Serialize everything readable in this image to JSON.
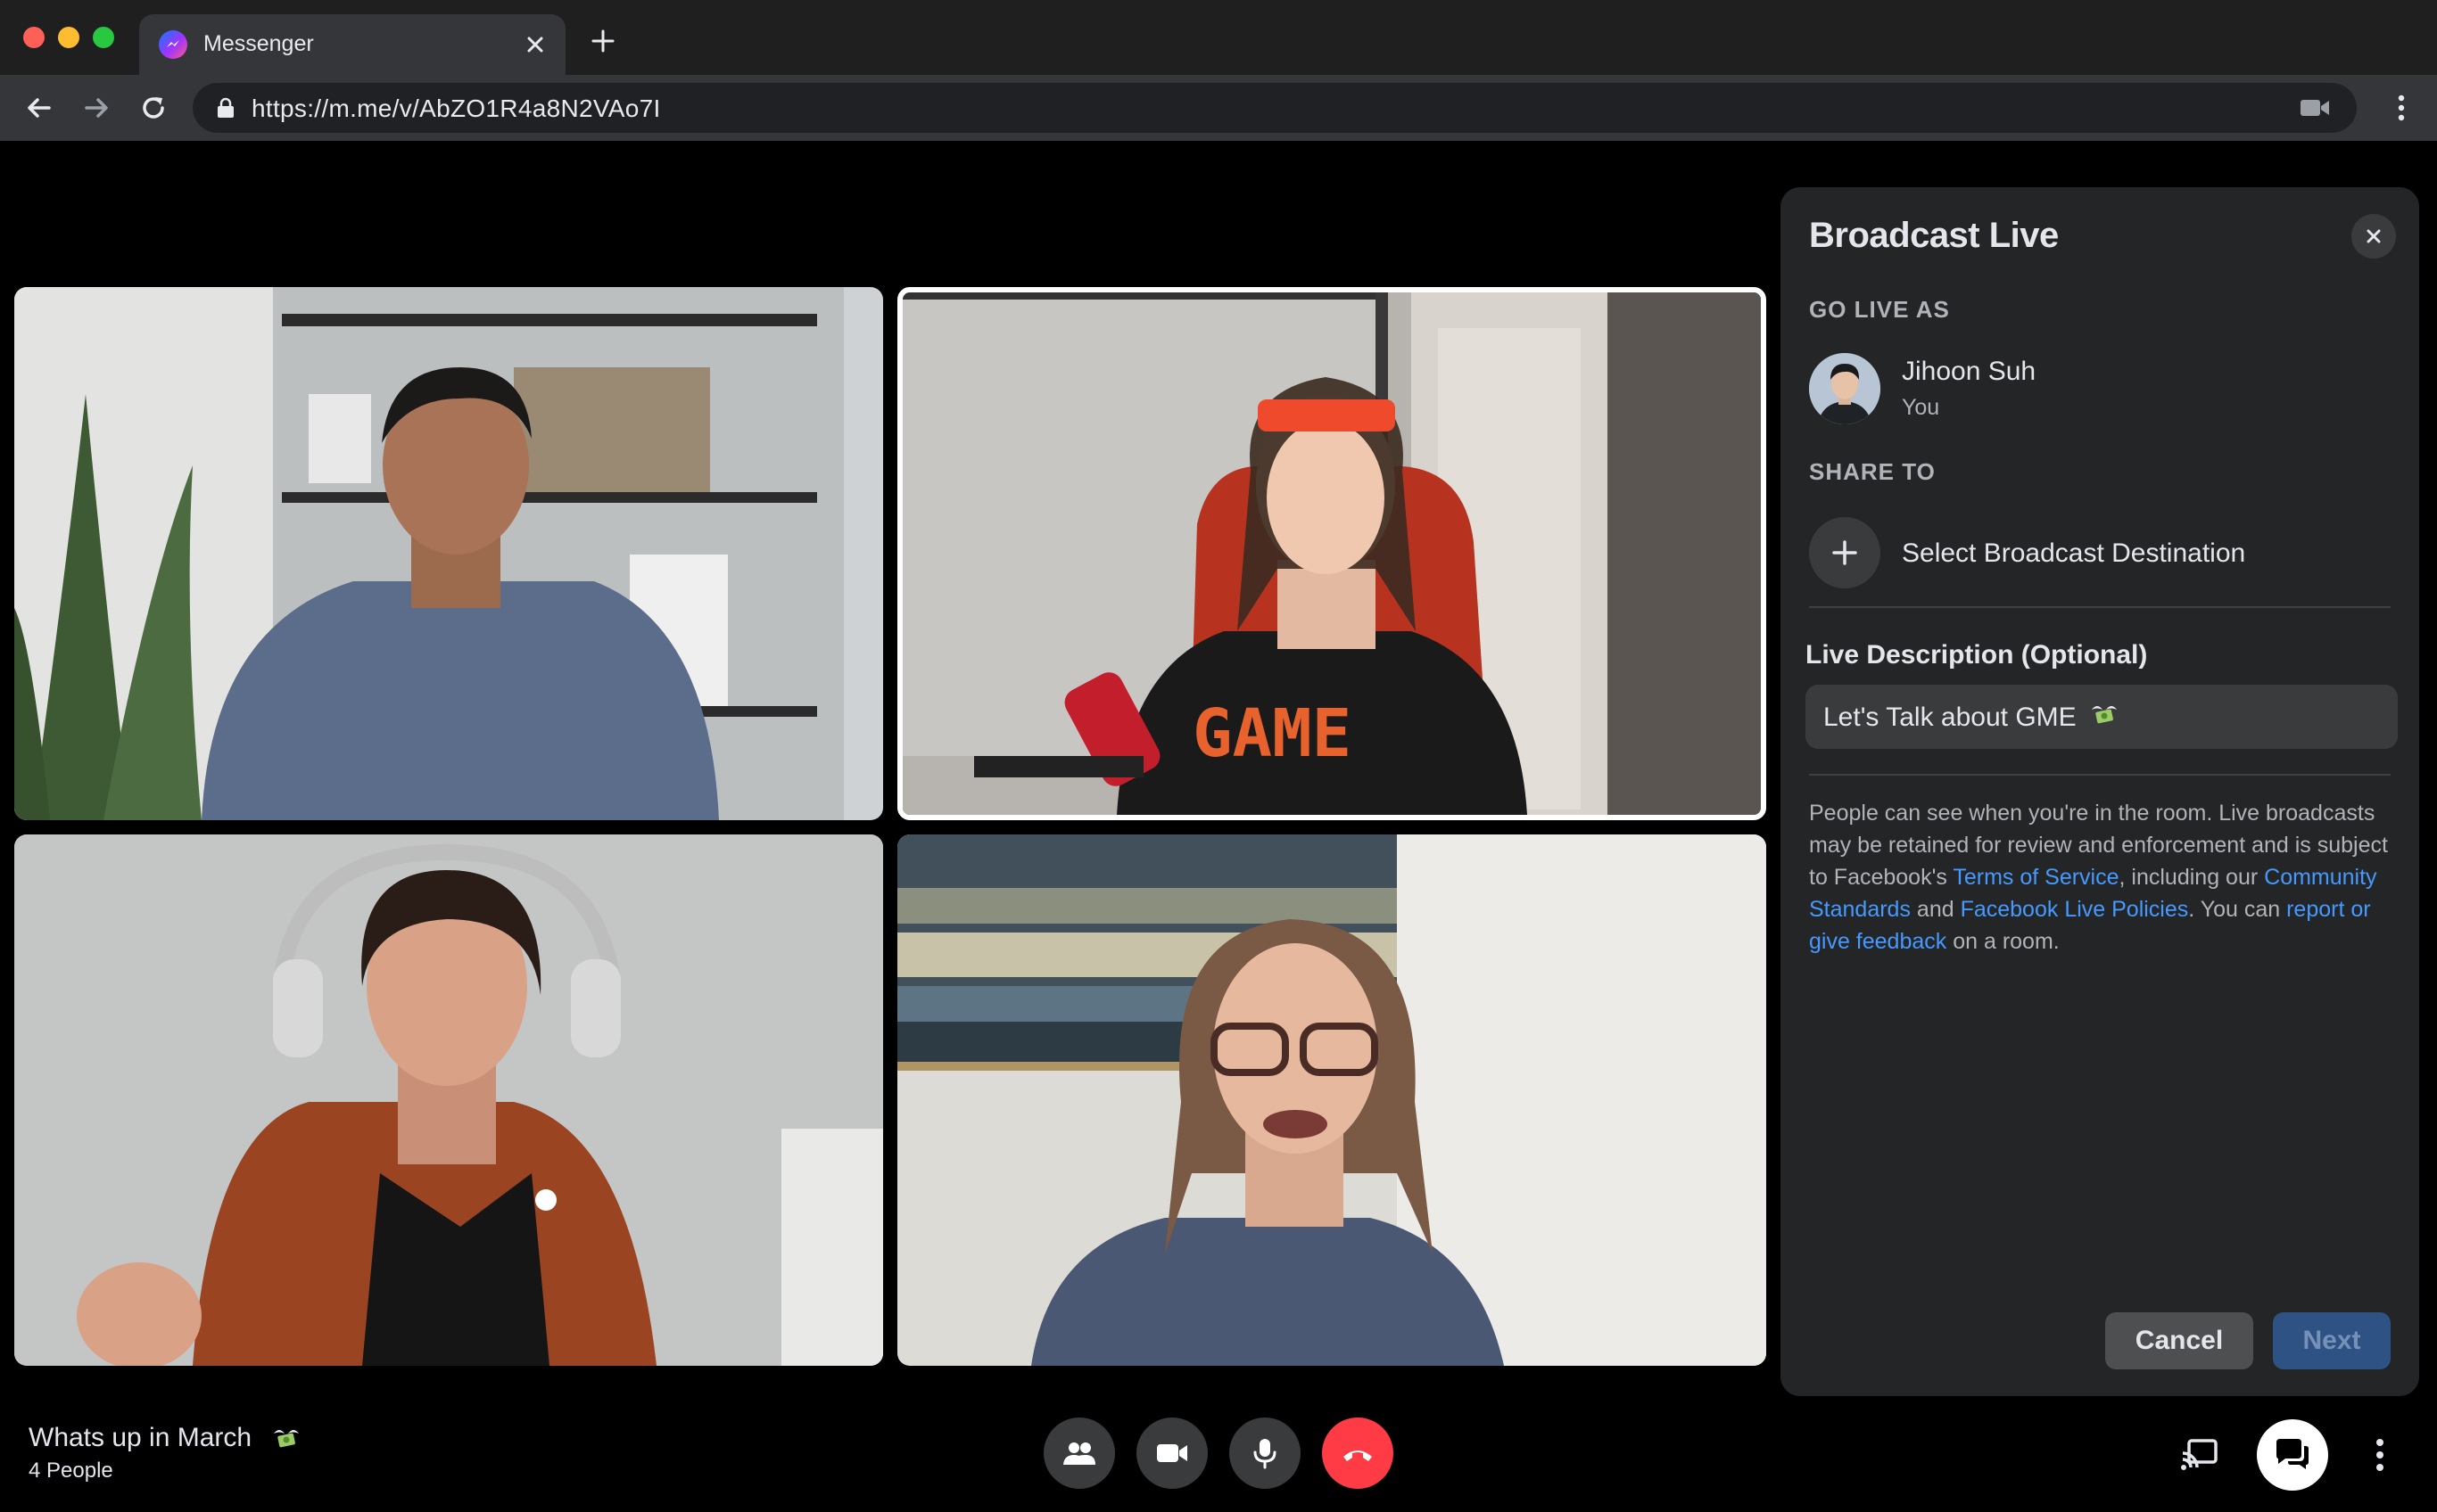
{
  "browser": {
    "tab_title": "Messenger",
    "url": "https://m.me/v/AbZO1R4a8N2VAo7I"
  },
  "video_grid": {
    "participants": [
      {
        "position": "top-left",
        "active_speaker": false
      },
      {
        "position": "top-right",
        "active_speaker": true,
        "shirt_text": "GAME"
      },
      {
        "position": "bottom-left",
        "active_speaker": false
      },
      {
        "position": "bottom-right",
        "active_speaker": false
      }
    ]
  },
  "broadcast_panel": {
    "title": "Broadcast Live",
    "go_live_as_label": "GO LIVE AS",
    "user_name": "Jihoon Suh",
    "user_subtitle": "You",
    "share_to_label": "SHARE TO",
    "destination_label": "Select Broadcast Destination",
    "description_label": "Live Description (Optional)",
    "description_value": "Let's Talk about GME",
    "legal": {
      "part1": "People can see when you're in the room. Live broadcasts may be retained for review and enforcement and is subject to Facebook's ",
      "link_terms": "Terms of Service",
      "part2": ", including our ",
      "link_community": "Community Standards",
      "part3": " and ",
      "link_policies": "Facebook Live Policies",
      "part4": ". You can ",
      "link_feedback": "report or give feedback",
      "part5": " on a room."
    },
    "cancel_label": "Cancel",
    "next_label": "Next"
  },
  "call_bar": {
    "room_name": "Whats up in March",
    "people_count": "4 People",
    "icons": [
      "people-icon",
      "video-camera-icon",
      "microphone-icon",
      "end-call-icon",
      "cast-icon",
      "chat-icon",
      "more-options-icon"
    ]
  },
  "colors": {
    "accent_link": "#4599ff",
    "end_call": "#ff3b45",
    "panel_bg": "#242526",
    "next_disabled": "#2e5283"
  }
}
